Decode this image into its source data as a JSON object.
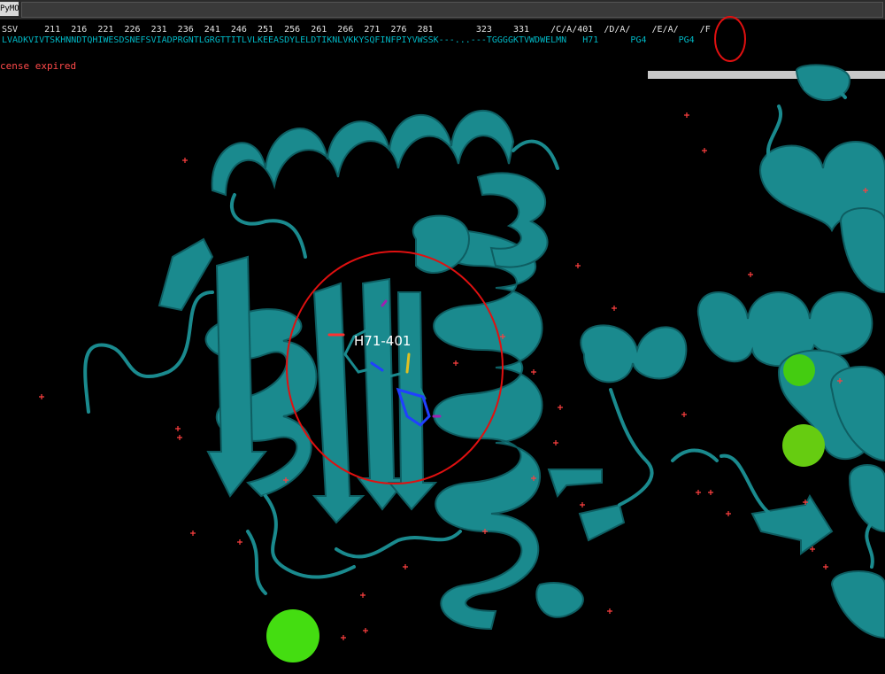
{
  "command_bar": {
    "prompt": "PyMOL>"
  },
  "sequence": {
    "numbers_row": "SSV     211  216  221  226  231  236  241  246  251  256  261  266  271  276  281        323    331    /C/A/401  /D/A/    /E/A/    /F",
    "residues_row": "LVADKVIVTSKHNNDTQHIWESDSNEFSVIADPRGNTLGRGTTITLVLKEEASDYLELDTIKNLVKKYSQFINFPIYVWSSK---...---TGGGGKTVWDWELMN   H71      PG4      PG4"
  },
  "license_message": "cense expired",
  "viewer": {
    "residue_label": "H71-401",
    "colors": {
      "cartoon": "#1a8a8e",
      "cartoon_dark": "#0e5e62",
      "water": "#ff4040",
      "ion": "#44dd11",
      "annotation": "#e01010"
    }
  }
}
